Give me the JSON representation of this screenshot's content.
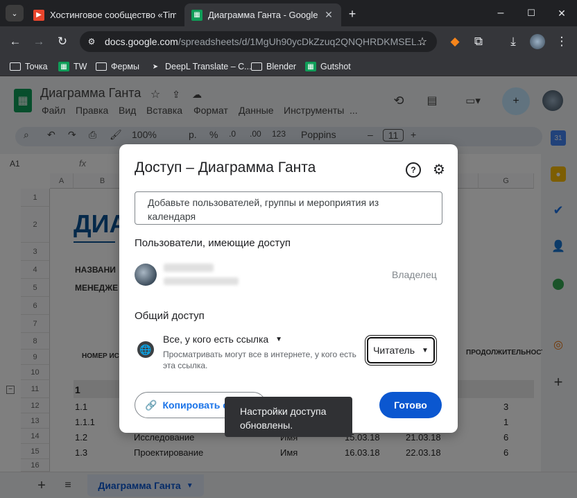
{
  "browser": {
    "tabs": [
      {
        "title": "Хостинговое сообщество «Tim",
        "active": false
      },
      {
        "title": "Диаграмма Ганта - Google Таб",
        "active": true
      }
    ],
    "new_tab": "+",
    "window_controls": {
      "minimize": "–",
      "maximize": "☐",
      "close": "✕"
    },
    "url_host": "docs.google.com",
    "url_path": "/spreadsheets/d/1MgUh90ycDkZzuq2QNQHRDKMSEL...",
    "bookmarks": [
      "Точка",
      "TW",
      "Фермы",
      "DeepL Translate – C...",
      "Blender",
      "Gutshot"
    ]
  },
  "sheets": {
    "title": "Диаграмма Ганта",
    "menu": [
      "Файл",
      "Правка",
      "Вид",
      "Вставка",
      "Формат",
      "Данные",
      "Инструменты",
      "..."
    ],
    "toolbar": {
      "zoom": "100%",
      "currency": "р.",
      "percent": "%",
      "dec_less": ".0",
      "dec_more": ".00",
      "number_fmt": "123",
      "font": "Poppins",
      "font_size": "11",
      "minus": "–",
      "plus": "+"
    },
    "cell_ref": "A1",
    "fx": "fx",
    "columns": [
      "A",
      "B",
      "G"
    ],
    "rows": [
      "1",
      "2",
      "3",
      "4",
      "5",
      "6",
      "7",
      "8",
      "9",
      "10",
      "11",
      "12",
      "13",
      "14",
      "15",
      "16"
    ],
    "big_title": "ДИА",
    "label_name": "НАЗВАНИ",
    "label_manager": "МЕНЕДЖЕ",
    "header_num": "НОМЕР ИС",
    "header_duration": "ПРОДОЛЖИТЕЛЬНОСТЬ",
    "task_rows": [
      {
        "num": "1",
        "name": "",
        "owner": "",
        "start": "",
        "end": "",
        "dur": ""
      },
      {
        "num": "1.1",
        "name": "",
        "owner": "",
        "start": "",
        "end": "",
        "dur": "3"
      },
      {
        "num": "1.1.1",
        "name": "",
        "owner": "",
        "start": "",
        "end": "",
        "dur": "1"
      },
      {
        "num": "1.2",
        "name": "Исследование",
        "owner": "Имя",
        "start": "15.03.18",
        "end": "21.03.18",
        "dur": "6"
      },
      {
        "num": "1.3",
        "name": "Проектирование",
        "owner": "Имя",
        "start": "16.03.18",
        "end": "22.03.18",
        "dur": "6"
      }
    ],
    "sheet_tab": "Диаграмма Ганта"
  },
  "dialog": {
    "title": "Доступ – Диаграмма Ганта",
    "add_placeholder": "Добавьте пользователей, группы и мероприятия из календаря",
    "users_heading": "Пользователи, имеющие доступ",
    "owner_role": "Владелец",
    "general_heading": "Общий доступ",
    "link_scope": "Все, у кого есть ссылка",
    "link_desc": "Просматривать могут все в интернете, у кого есть эта ссылка.",
    "role": "Читатель",
    "copy_link": "Копировать ссылку",
    "done": "Готово"
  },
  "toast": "Настройки доступа обновлены.",
  "colors": {
    "accent": "#0b57d0",
    "sheets_green": "#0f9d58",
    "link_blue": "#1a73e8",
    "title_blue": "#0b5394"
  }
}
